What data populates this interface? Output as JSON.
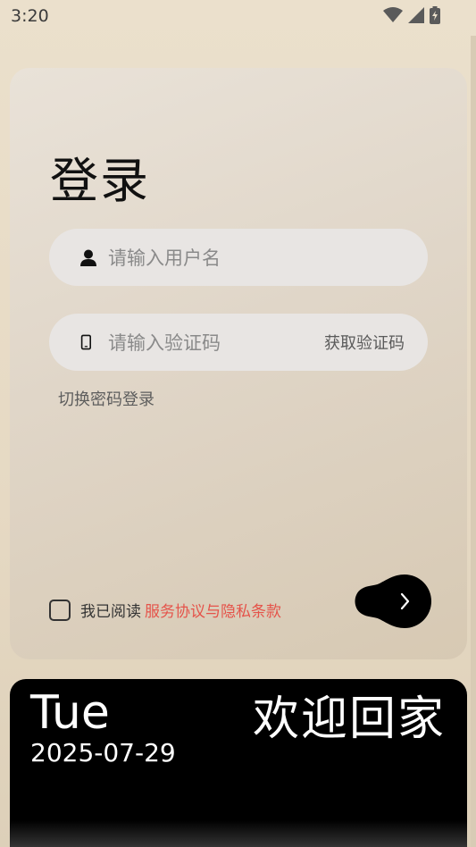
{
  "status_bar": {
    "time": "3:20",
    "icons": [
      "wifi-icon",
      "cellular-signal-icon",
      "battery-charging-icon"
    ]
  },
  "login": {
    "title": "登录",
    "username": {
      "placeholder": "请输入用户名",
      "icon": "user-icon"
    },
    "code": {
      "placeholder": "请输入验证码",
      "icon": "phone-icon",
      "get_code_label": "获取验证码"
    },
    "switch_label": "切换密码登录",
    "agreement": {
      "prefix": "我已阅读",
      "link": "服务协议与隐私条款",
      "checked": false
    },
    "submit_icon": "chevron-right-icon"
  },
  "bottom_card": {
    "day": "Tue",
    "date": "2025-07-29",
    "welcome": "欢迎回家"
  },
  "colors": {
    "background": "#ebe0cc",
    "field_bg": "#e8e5e3",
    "link": "#e5534a",
    "bottom_card": "#000000"
  }
}
